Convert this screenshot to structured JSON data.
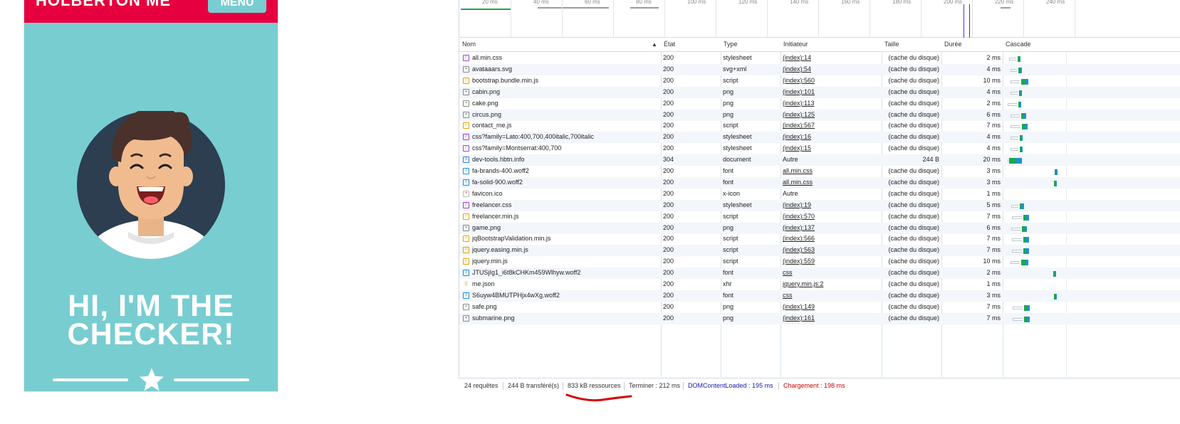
{
  "preview": {
    "brand": "HOLBERTON ME",
    "menu_label": "MENU",
    "hero_line1": "HI, I'M THE",
    "hero_line2": "CHECKER!",
    "colors": {
      "navbar": "#e7003f",
      "background": "#78cdd1",
      "avatar_circle": "#2c3e50"
    }
  },
  "timeline": {
    "tick_labels": [
      "20 ms",
      "40 ms",
      "60 ms",
      "80 ms",
      "100 ms",
      "120 ms",
      "140 ms",
      "160 ms",
      "180 ms",
      "200 ms",
      "220 ms",
      "240 ms"
    ]
  },
  "table": {
    "headers": {
      "name": "Nom",
      "status": "État",
      "type": "Type",
      "initiator": "Initiateur",
      "size": "Taille",
      "time": "Durée",
      "waterfall": "Cascade"
    },
    "rows": [
      {
        "name": "all.min.css",
        "status": "200",
        "type": "stylesheet",
        "initiator": "(index):14",
        "size": "(cache du disque)",
        "time": "2 ms",
        "icon": "css-icon"
      },
      {
        "name": "avataaars.svg",
        "status": "200",
        "type": "svg+xml",
        "initiator": "(index):54",
        "size": "(cache du disque)",
        "time": "4 ms",
        "icon": "image-icon"
      },
      {
        "name": "bootstrap.bundle.min.js",
        "status": "200",
        "type": "script",
        "initiator": "(index):560",
        "size": "(cache du disque)",
        "time": "10 ms",
        "icon": "script-icon"
      },
      {
        "name": "cabin.png",
        "status": "200",
        "type": "png",
        "initiator": "(index):101",
        "size": "(cache du disque)",
        "time": "4 ms",
        "icon": "image-icon"
      },
      {
        "name": "cake.png",
        "status": "200",
        "type": "png",
        "initiator": "(index):113",
        "size": "(cache du disque)",
        "time": "2 ms",
        "icon": "image-icon"
      },
      {
        "name": "circus.png",
        "status": "200",
        "type": "png",
        "initiator": "(index):125",
        "size": "(cache du disque)",
        "time": "6 ms",
        "icon": "image-icon"
      },
      {
        "name": "contact_me.js",
        "status": "200",
        "type": "script",
        "initiator": "(index):567",
        "size": "(cache du disque)",
        "time": "7 ms",
        "icon": "script-icon"
      },
      {
        "name": "css?family=Lato:400,700,400italic,700italic",
        "status": "200",
        "type": "stylesheet",
        "initiator": "(index):16",
        "size": "(cache du disque)",
        "time": "4 ms",
        "icon": "css-icon"
      },
      {
        "name": "css?family=Montserrat:400,700",
        "status": "200",
        "type": "stylesheet",
        "initiator": "(index):15",
        "size": "(cache du disque)",
        "time": "4 ms",
        "icon": "css-icon"
      },
      {
        "name": "dev-tools.hbtn.info",
        "status": "304",
        "type": "document",
        "initiator": "Autre",
        "size": "244 B",
        "time": "20 ms",
        "icon": "document-icon"
      },
      {
        "name": "fa-brands-400.woff2",
        "status": "200",
        "type": "font",
        "initiator": "all.min.css",
        "size": "(cache du disque)",
        "time": "3 ms",
        "icon": "font-icon"
      },
      {
        "name": "fa-solid-900.woff2",
        "status": "200",
        "type": "font",
        "initiator": "all.min.css",
        "size": "(cache du disque)",
        "time": "3 ms",
        "icon": "font-icon"
      },
      {
        "name": "favicon.ico",
        "status": "200",
        "type": "x-icon",
        "initiator": "Autre",
        "size": "(cache du disque)",
        "time": "1 ms",
        "icon": "favicon-icon"
      },
      {
        "name": "freelancer.css",
        "status": "200",
        "type": "stylesheet",
        "initiator": "(index):19",
        "size": "(cache du disque)",
        "time": "5 ms",
        "icon": "css-icon"
      },
      {
        "name": "freelancer.min.js",
        "status": "200",
        "type": "script",
        "initiator": "(index):570",
        "size": "(cache du disque)",
        "time": "7 ms",
        "icon": "script-icon"
      },
      {
        "name": "game.png",
        "status": "200",
        "type": "png",
        "initiator": "(index):137",
        "size": "(cache du disque)",
        "time": "6 ms",
        "icon": "image-icon"
      },
      {
        "name": "jqBootstrapValidation.min.js",
        "status": "200",
        "type": "script",
        "initiator": "(index):566",
        "size": "(cache du disque)",
        "time": "7 ms",
        "icon": "script-icon"
      },
      {
        "name": "jquery.easing.min.js",
        "status": "200",
        "type": "script",
        "initiator": "(index):563",
        "size": "(cache du disque)",
        "time": "7 ms",
        "icon": "script-icon"
      },
      {
        "name": "jquery.min.js",
        "status": "200",
        "type": "script",
        "initiator": "(index):559",
        "size": "(cache du disque)",
        "time": "10 ms",
        "icon": "script-icon"
      },
      {
        "name": "JTUSjIg1_i6t8kCHKm459Wlhyw.woff2",
        "status": "200",
        "type": "font",
        "initiator": "css",
        "size": "(cache du disque)",
        "time": "2 ms",
        "icon": "font-icon"
      },
      {
        "name": "me.json",
        "status": "200",
        "type": "xhr",
        "initiator": "jquery.min.js:2",
        "size": "(cache du disque)",
        "time": "1 ms",
        "icon": "xhr-icon"
      },
      {
        "name": "S6uyw4BMUTPHjx4wXg.woff2",
        "status": "200",
        "type": "font",
        "initiator": "css",
        "size": "(cache du disque)",
        "time": "3 ms",
        "icon": "font-icon"
      },
      {
        "name": "safe.png",
        "status": "200",
        "type": "png",
        "initiator": "(index):149",
        "size": "(cache du disque)",
        "time": "7 ms",
        "icon": "image-icon"
      },
      {
        "name": "submarine.png",
        "status": "200",
        "type": "png",
        "initiator": "(index):161",
        "size": "(cache du disque)",
        "time": "7 ms",
        "icon": "image-icon"
      }
    ]
  },
  "footer": {
    "requests": "24 requêtes",
    "transferred": "244 B transféré(s)",
    "resources": "833 kB ressources",
    "finish": "Terminer : 212 ms",
    "dom_content_loaded": "DOMContentLoaded : 195 ms",
    "load": "Chargement : 198 ms",
    "colors": {
      "dom": "#1a1aa6",
      "load": "#c80000",
      "highlight": "#d40000"
    }
  }
}
